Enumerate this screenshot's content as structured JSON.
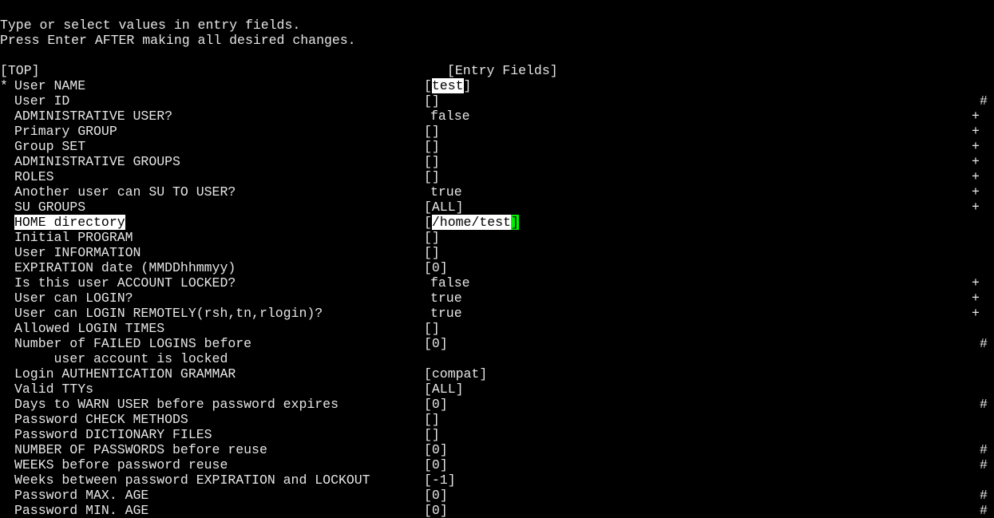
{
  "instructions": [
    "Type or select values in entry fields.",
    "Press Enter AFTER making all desired changes."
  ],
  "top_marker": "[TOP]",
  "entry_header": "[Entry Fields]",
  "colors": {
    "text": "#e6e6e6",
    "background": "#000000",
    "highlight": "#ffffff",
    "cursor": "#00ee00"
  },
  "fields": [
    {
      "required": "*",
      "label": "User NAME",
      "value": "test",
      "bracketed": true,
      "marker": "",
      "highlight_value": true
    },
    {
      "label": "User ID",
      "value": "",
      "bracketed": true,
      "marker": "#"
    },
    {
      "label": "ADMINISTRATIVE USER?",
      "value": "false",
      "bracketed": false,
      "marker": "+"
    },
    {
      "label": "Primary GROUP",
      "value": "",
      "bracketed": true,
      "marker": "+"
    },
    {
      "label": "Group SET",
      "value": "",
      "bracketed": true,
      "marker": "+"
    },
    {
      "label": "ADMINISTRATIVE GROUPS",
      "value": "",
      "bracketed": true,
      "marker": "+"
    },
    {
      "label": "ROLES",
      "value": "",
      "bracketed": true,
      "marker": "+"
    },
    {
      "label": "Another user can SU TO USER?",
      "value": "true",
      "bracketed": false,
      "marker": "+"
    },
    {
      "label": "SU GROUPS",
      "value": "ALL",
      "bracketed": true,
      "marker": "+"
    },
    {
      "label": "HOME directory",
      "value": "/home/test",
      "bracketed": true,
      "marker": "",
      "highlight_label": true,
      "highlight_value": true,
      "cursor": true
    },
    {
      "label": "Initial PROGRAM",
      "value": "",
      "bracketed": true,
      "marker": ""
    },
    {
      "label": "User INFORMATION",
      "value": "",
      "bracketed": true,
      "marker": ""
    },
    {
      "label": "EXPIRATION date (MMDDhhmmyy)",
      "value": "0",
      "bracketed": true,
      "marker": ""
    },
    {
      "label": "Is this user ACCOUNT LOCKED?",
      "value": "false",
      "bracketed": false,
      "marker": "+"
    },
    {
      "label": "User can LOGIN?",
      "value": "true",
      "bracketed": false,
      "marker": "+"
    },
    {
      "label": "User can LOGIN REMOTELY(rsh,tn,rlogin)?",
      "value": "true",
      "bracketed": false,
      "marker": "+"
    },
    {
      "label": "Allowed LOGIN TIMES",
      "value": "",
      "bracketed": true,
      "marker": ""
    },
    {
      "label": "Number of FAILED LOGINS before",
      "label2": "     user account is locked",
      "value": "0",
      "bracketed": true,
      "marker": "#"
    },
    {
      "label": "Login AUTHENTICATION GRAMMAR",
      "value": "compat",
      "bracketed": true,
      "marker": ""
    },
    {
      "label": "Valid TTYs",
      "value": "ALL",
      "bracketed": true,
      "marker": ""
    },
    {
      "label": "Days to WARN USER before password expires",
      "value": "0",
      "bracketed": true,
      "marker": "#"
    },
    {
      "label": "Password CHECK METHODS",
      "value": "",
      "bracketed": true,
      "marker": ""
    },
    {
      "label": "Password DICTIONARY FILES",
      "value": "",
      "bracketed": true,
      "marker": ""
    },
    {
      "label": "NUMBER OF PASSWORDS before reuse",
      "value": "0",
      "bracketed": true,
      "marker": "#"
    },
    {
      "label": "WEEKS before password reuse",
      "value": "0",
      "bracketed": true,
      "marker": "#"
    },
    {
      "label": "Weeks between password EXPIRATION and LOCKOUT",
      "value": "-1",
      "bracketed": true,
      "marker": ""
    },
    {
      "label": "Password MAX. AGE",
      "value": "0",
      "bracketed": true,
      "marker": "#"
    },
    {
      "label": "Password MIN. AGE",
      "value": "0",
      "bracketed": true,
      "marker": "#"
    }
  ]
}
